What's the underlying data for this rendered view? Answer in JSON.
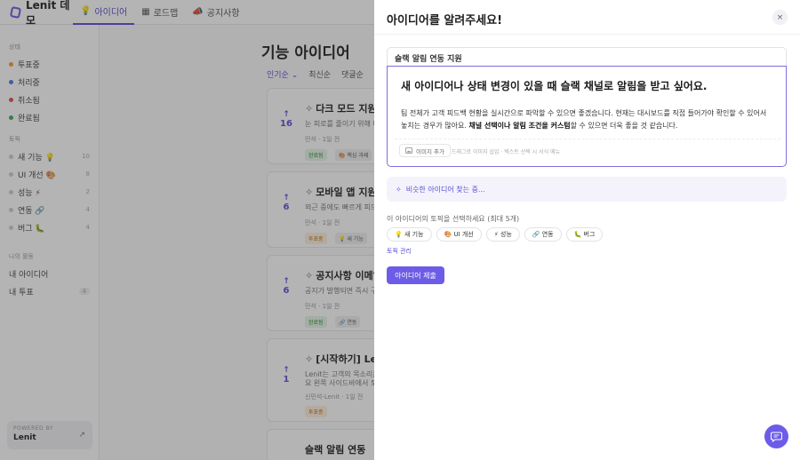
{
  "app": {
    "name": "Lenit 데모"
  },
  "nav": {
    "tabs": [
      {
        "label": "아이디어",
        "icon": "💡"
      },
      {
        "label": "로드맵",
        "icon": "▦"
      },
      {
        "label": "공지사항",
        "icon": "📣"
      }
    ]
  },
  "sidebar": {
    "status_label": "상태",
    "statuses": [
      {
        "label": "투표중",
        "color": "#f0a030"
      },
      {
        "label": "처리중",
        "color": "#4a7be0"
      },
      {
        "label": "취소됨",
        "color": "#e05050"
      },
      {
        "label": "완료됨",
        "color": "#40a860"
      }
    ],
    "topics_label": "토픽",
    "topics": [
      {
        "label": "새 기능 💡",
        "count": "10"
      },
      {
        "label": "UI 개선 🎨",
        "count": "8"
      },
      {
        "label": "성능 ⚡",
        "count": "2"
      },
      {
        "label": "연동 🔗",
        "count": "4"
      },
      {
        "label": "버그 🐛",
        "count": "4"
      }
    ],
    "activity_label": "나의 활동",
    "my_ideas": "내 아이디어",
    "my_votes": "내 투표",
    "my_votes_count": "4",
    "powered_by": "POWERED BY",
    "powered_name": "Lenit"
  },
  "main": {
    "title": "기능 아이디어",
    "sorts": [
      "인기순 ⌄",
      "최신순",
      "댓글순"
    ],
    "cards": [
      {
        "votes": "16",
        "title": "다크 모드 지원",
        "desc": "눈 피로를 줄이기 위해 다",
        "author": "민석",
        "time": "1일 전",
        "tags": [
          "완료됨",
          "🎨 핵심 과제"
        ]
      },
      {
        "votes": "6",
        "title": "모바일 앱 지원",
        "desc": "외근 중에도 빠르게 피드백",
        "author": "민석",
        "time": "1일 전",
        "tags": [
          "투표중",
          "💡 새 기능"
        ]
      },
      {
        "votes": "6",
        "title": "공지사항 이메일 일",
        "desc": "공지가 발행되면 즉시 구독",
        "author": "민석",
        "time": "1일 전",
        "tags": [
          "완료됨",
          "🔗 연동"
        ]
      },
      {
        "votes": "1",
        "title": "[시작하기] Lenit",
        "desc": "Lenit는 고객의 목소리를 수",
        "desc2": "요 왼쪽 사이드바에서 토픽",
        "author": "신민석-Lenit",
        "time": "1일 전",
        "tags": [
          "투표중"
        ]
      },
      {
        "title": "슬랙 알림 연동"
      }
    ]
  },
  "modal": {
    "title": "아이디어를 알려주세요!",
    "close_icon": "×",
    "idea_title": "슬랙 알림 연동 지원",
    "heading": "새 아이디어나 상태 변경이 있을 때 슬랙 채널로 알림을 받고 싶어요.",
    "body_1": "팀 전체가 고객 피드백 현황을 실시간으로 파악할 수 있으면 좋겠습니다. 현재는 대시보드를 직접 들어가야 확인할 수 있어서 놓치는 경우가 많아요. ",
    "body_bold": "채널 선택이나 알림 조건을 커스텀",
    "body_2": "할 수 있으면 더욱 좋을 것 같습니다.",
    "add_image": "이미지 추가",
    "image_hint": "드래그로 이미지 삽입 · 텍스트 선택 시 서식 메뉴",
    "similar": "비슷한 아이디어 찾는 중...",
    "topic_label": "이 아이디어의 토픽을 선택하세요 (최대 5개)",
    "topics": [
      "💡 새 기능",
      "🎨 UI 개선",
      "⚡ 성능",
      "🔗 연동",
      "🐛 버그"
    ],
    "topic_manage": "토픽 관리",
    "submit": "아이디어 제출"
  }
}
